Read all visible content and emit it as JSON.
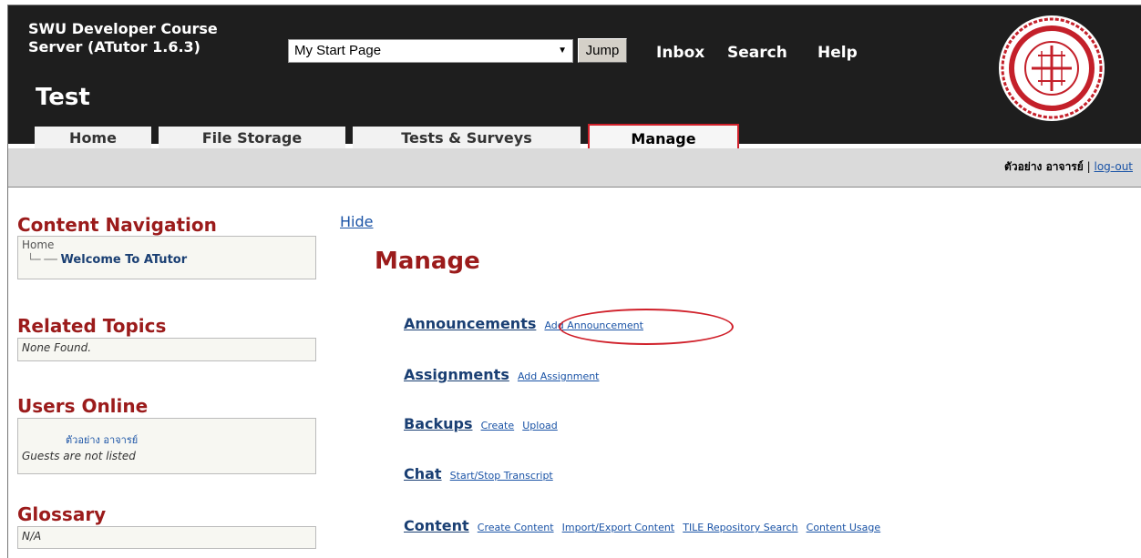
{
  "header": {
    "site_name_line1": "SWU Developer Course",
    "site_name_line2": "Server (ATutor 1.6.3)",
    "course_title": "Test",
    "jump_select_value": "My Start Page",
    "jump_button": "Jump",
    "links": [
      "Inbox",
      "Search",
      "Help"
    ]
  },
  "tabs": [
    {
      "label": "Home",
      "active": false
    },
    {
      "label": "File Storage",
      "active": false
    },
    {
      "label": "Tests & Surveys",
      "active": false
    },
    {
      "label": "Manage",
      "active": true
    }
  ],
  "userbar": {
    "user_name": "ตัวอย่าง อาจารย์",
    "separator": "|",
    "logout": "log-out"
  },
  "sidebar": {
    "content_navigation": {
      "title": "Content Navigation",
      "root": "Home",
      "branch": "└─ ──",
      "item": "Welcome To ATutor"
    },
    "related_topics": {
      "title": "Related Topics",
      "text": "None Found."
    },
    "users_online": {
      "title": "Users Online",
      "user": "ตัวอย่าง  อาจารย์",
      "note": "Guests are not listed"
    },
    "glossary": {
      "title": "Glossary",
      "text": "N/A"
    }
  },
  "main": {
    "hide_link": "Hide",
    "title": "Manage",
    "sections": [
      {
        "name": "Announcements",
        "links": [
          "Add Announcement"
        ]
      },
      {
        "name": "Assignments",
        "links": [
          "Add Assignment"
        ]
      },
      {
        "name": "Backups",
        "links": [
          "Create",
          "Upload"
        ]
      },
      {
        "name": "Chat",
        "links": [
          "Start/Stop Transcript"
        ]
      },
      {
        "name": "Content",
        "links": [
          "Create Content",
          "Import/Export Content",
          "TILE Repository Search",
          "Content Usage"
        ]
      }
    ]
  },
  "colors": {
    "header_bg": "#1e1e1e",
    "accent_red": "#9b1b1b",
    "link_blue": "#1a53a6",
    "highlight_red": "#d0202a"
  },
  "icons": {
    "logo": "university-seal-logo",
    "select_arrow": "chevron-down-icon"
  }
}
